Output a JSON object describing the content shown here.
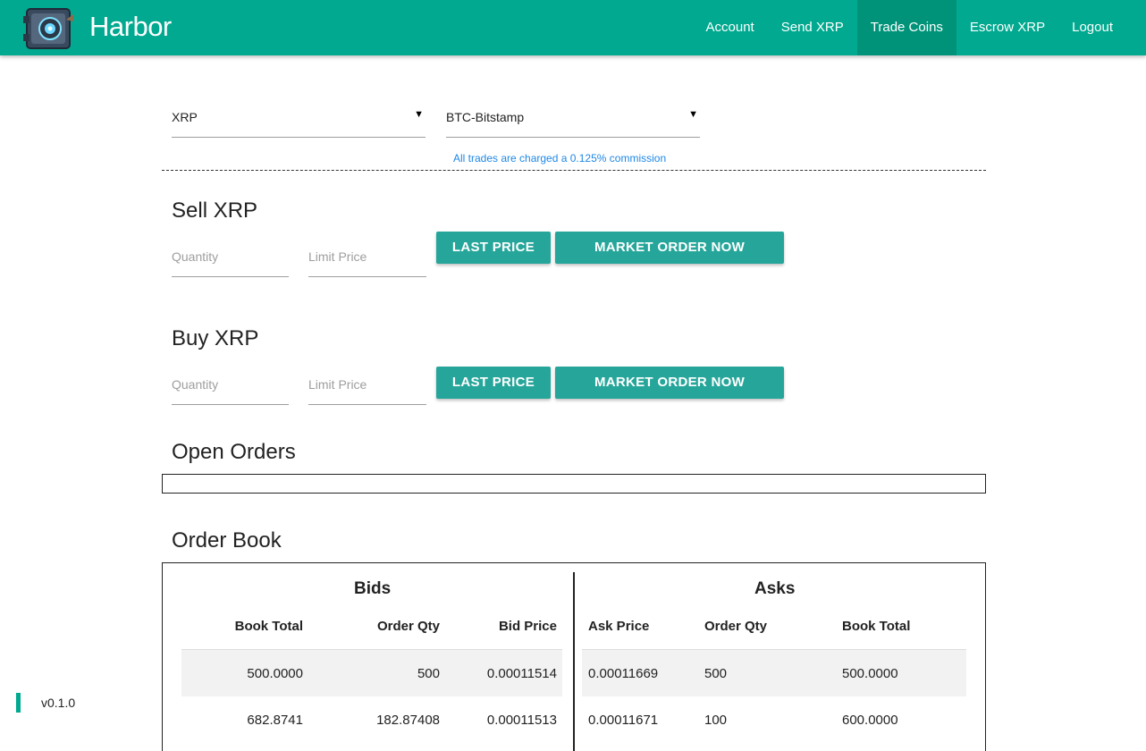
{
  "header": {
    "brand": "Harbor",
    "nav": [
      "Account",
      "Send XRP",
      "Trade Coins",
      "Escrow XRP",
      "Logout"
    ],
    "active_nav": "Trade Coins"
  },
  "selectors": {
    "base": "XRP",
    "counter": "BTC-Bitstamp",
    "commission_note": "All trades are charged a 0.125% commission"
  },
  "sell": {
    "title": "Sell XRP",
    "quantity_placeholder": "Quantity",
    "limit_placeholder": "Limit Price",
    "last_price_label": "LAST PRICE",
    "market_order_label": "MARKET ORDER NOW"
  },
  "buy": {
    "title": "Buy XRP",
    "quantity_placeholder": "Quantity",
    "limit_placeholder": "Limit Price",
    "last_price_label": "LAST PRICE",
    "market_order_label": "MARKET ORDER NOW"
  },
  "open_orders": {
    "title": "Open Orders"
  },
  "order_book": {
    "title": "Order Book",
    "bids": {
      "title": "Bids",
      "headers": [
        "Book Total",
        "Order Qty",
        "Bid Price"
      ],
      "rows": [
        [
          "500.0000",
          "500",
          "0.00011514"
        ],
        [
          "682.8741",
          "182.87408",
          "0.00011513"
        ]
      ]
    },
    "asks": {
      "title": "Asks",
      "headers": [
        "Ask Price",
        "Order Qty",
        "Book Total"
      ],
      "rows": [
        [
          "0.00011669",
          "500",
          "500.0000"
        ],
        [
          "0.00011671",
          "100",
          "600.0000"
        ]
      ]
    }
  },
  "footer": {
    "version": "v0.1.0"
  },
  "colors": {
    "brand": "#00a98f",
    "button": "#26a69a",
    "link": "#1e88e5"
  }
}
